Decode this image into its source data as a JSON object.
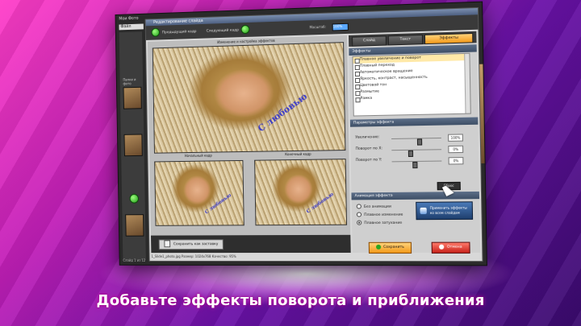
{
  "caption": "Добавьте эффекты поворота и приближения",
  "main_window": {
    "title": "Мои Фото",
    "menu": "Файл",
    "left_label": "Папки и фото",
    "status": "Слайд 1 из 12"
  },
  "dialog": {
    "title": "Редактирование слайда",
    "toolbar": {
      "prev_label": "Предыдущий кадр",
      "next_label": "Следующий кадр",
      "zoom_label": "Масштаб:",
      "zoom_value": "100%"
    },
    "preview": {
      "main_label": "Изменение и настройка эффектов",
      "start_label": "Начальный кадр",
      "end_label": "Конечный кадр",
      "watermark": "С любовью"
    },
    "save_frame_button": "Сохранить как заставку",
    "tabs": [
      "Слайд",
      "Текст",
      "Эффекты"
    ],
    "effects_section": "Эффекты",
    "effects": [
      "Плавное увеличение и поворот",
      "Плавный переход",
      "Автоматическое вращение",
      "Яркость, контраст, насыщенность",
      "Цветовой тон",
      "Размытие",
      "Рамка"
    ],
    "params_section": "Параметры эффекта",
    "params": [
      {
        "label": "Увеличение:",
        "value": "100%",
        "level": 0.55
      },
      {
        "label": "Поворот по X:",
        "value": "0%",
        "level": 0.35
      },
      {
        "label": "Поворот по Y:",
        "value": "0%",
        "level": 0.45
      }
    ],
    "apply_small_button": "Сброс",
    "animation_section": "Анимация эффекта",
    "radio_options": [
      "Без анимации",
      "Плавное изменение",
      "Плавное затухание"
    ],
    "radio_selected": 2,
    "apply_anim_button": "Применить эффекты ко всем слайдам",
    "ok_button": "Сохранить",
    "cancel_button": "Отмена",
    "status": "1_Slide1_photo.jpg   Размер: 1024x768   Качество: 95%"
  }
}
